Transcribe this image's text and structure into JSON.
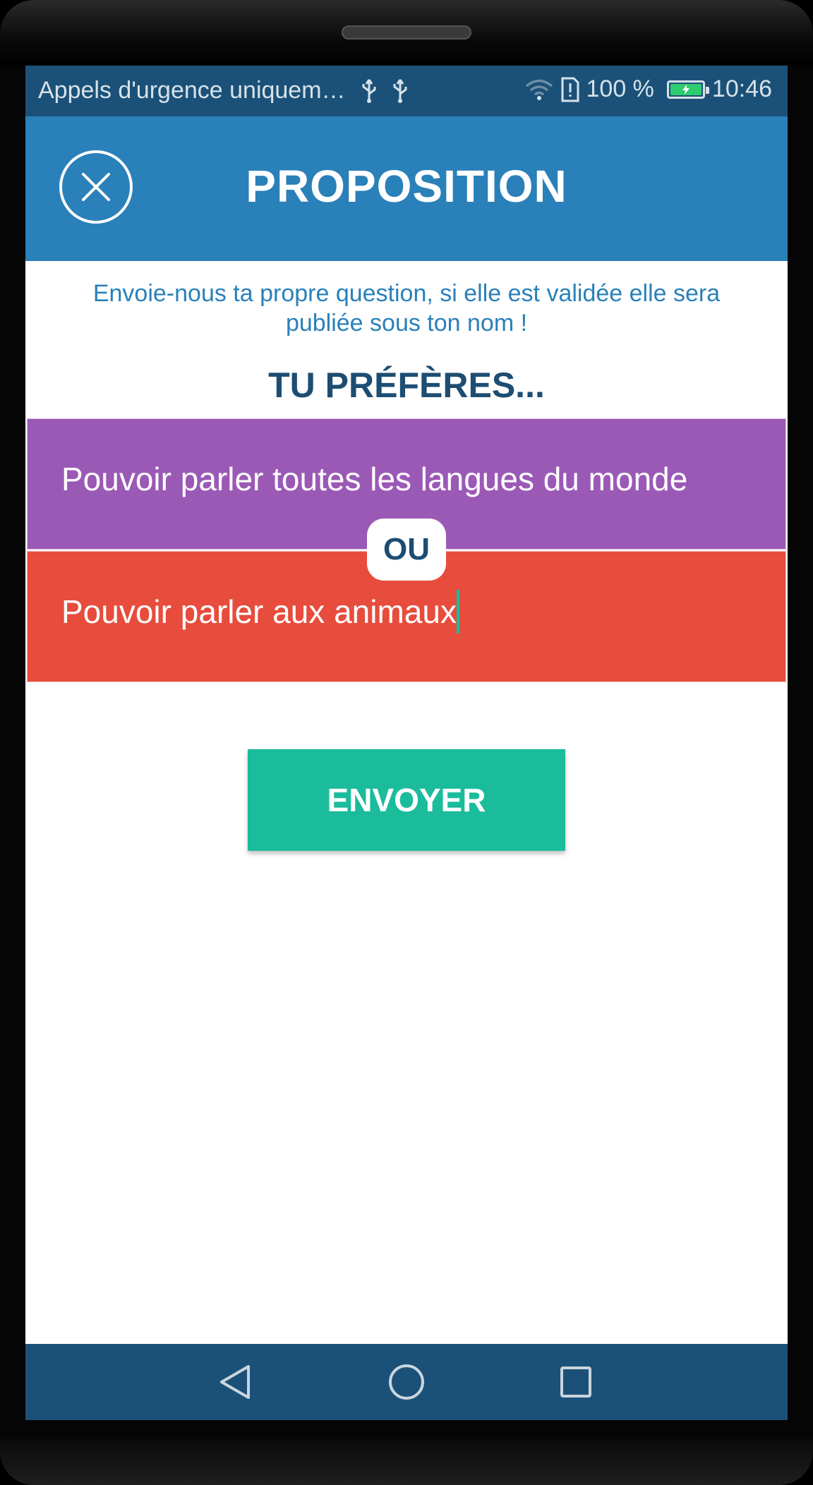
{
  "status_bar": {
    "carrier_text": "Appels d'urgence uniquem…",
    "battery_percent": "100 %",
    "battery_level": 1.0,
    "time": "10:46",
    "icons": [
      "usb-icon",
      "usb-icon",
      "wifi-icon",
      "sim-alert-icon",
      "battery-icon"
    ]
  },
  "header": {
    "title": "PROPOSITION",
    "close_icon": "close-icon"
  },
  "intro_text": "Envoie-nous ta propre question, si elle est validée elle sera publiée sous ton nom !",
  "subtitle": "TU PRÉFÈRES...",
  "options": {
    "first": "Pouvoir parler toutes les langues du monde",
    "or_label": "OU",
    "second": "Pouvoir parler aux animaux"
  },
  "send_button": "ENVOYER",
  "nav_bar": {
    "icons": [
      "back-icon",
      "home-icon",
      "recents-icon"
    ]
  },
  "colors": {
    "status_bar": "#1b5178",
    "header": "#2a80b9",
    "option_first": "#9b59b6",
    "option_second": "#e74c3c",
    "send_button": "#1abc9c",
    "title_dark": "#1d4d72"
  }
}
